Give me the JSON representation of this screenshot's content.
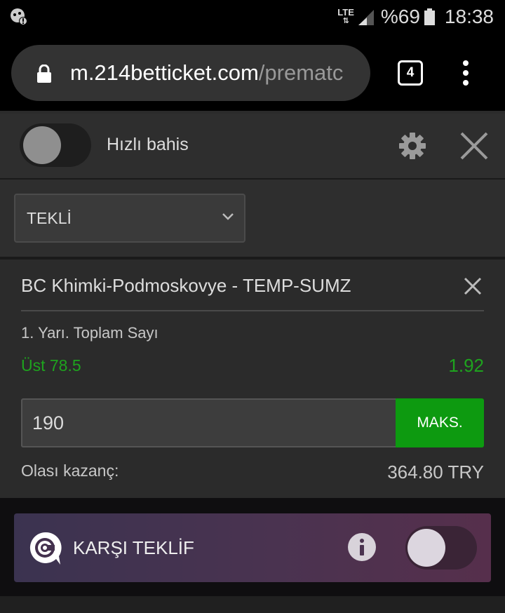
{
  "status_bar": {
    "network": "LTE",
    "battery": "%69",
    "time": "18:38"
  },
  "browser": {
    "url_host": "m.214betticket.com",
    "url_path": "/prematc",
    "tab_count": "4"
  },
  "quick_bet": {
    "label": "Hızlı bahis",
    "enabled": false
  },
  "bet_type": {
    "selected": "TEKLİ"
  },
  "bet": {
    "match": "BC Khimki-Podmoskovye - TEMP-SUMZ",
    "market": "1. Yarı. Toplam Sayı",
    "selection": "Üst 78.5",
    "odds": "1.92",
    "stake": "190",
    "max_label": "MAKS.",
    "potential_win_label": "Olası kazanç:",
    "potential_win_value": "364.80 TRY"
  },
  "counter_offer": {
    "label": "KARŞI TEKLİF",
    "enabled": false
  },
  "colors": {
    "accent_green": "#0d9a10",
    "odds_green": "#1ea31e",
    "counter_purple": "#4a3350"
  }
}
